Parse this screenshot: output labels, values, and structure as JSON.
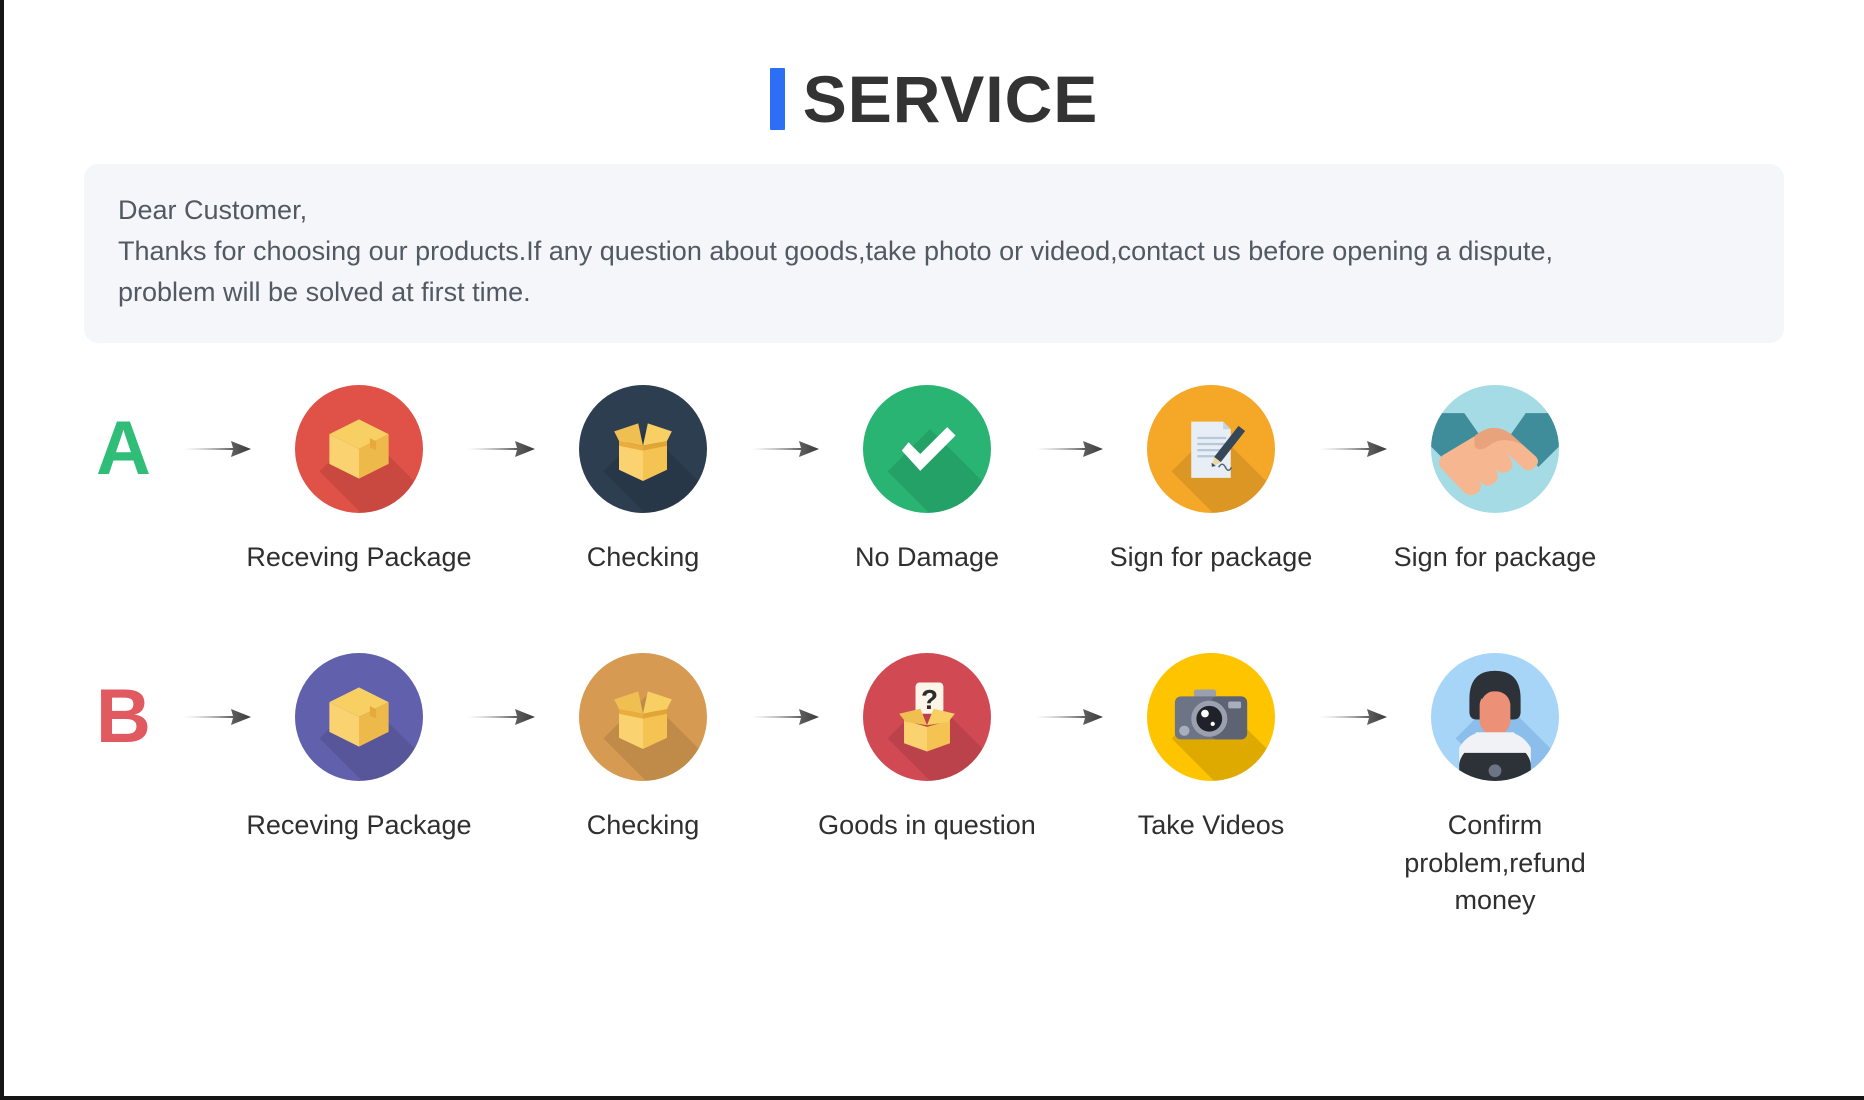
{
  "header": {
    "accent_color": "#2c6ef5",
    "title": "SERVICE"
  },
  "notice": {
    "background_color": "#f4f6f9",
    "line1": "Dear Customer,",
    "line2": "Thanks for choosing our products.If any question about goods,take photo or videod,contact us before opening a dispute,",
    "line3": "problem will be solved at first time."
  },
  "flows": [
    {
      "letter": "A",
      "letter_color": "#2fbd77",
      "steps": [
        {
          "label": "Receving Package",
          "icon": "closed-package-icon",
          "circle_color": "#e05147"
        },
        {
          "label": "Checking",
          "icon": "open-box-icon",
          "circle_color": "#2d3e50"
        },
        {
          "label": "No Damage",
          "icon": "checkmark-icon",
          "circle_color": "#29b473"
        },
        {
          "label": "Sign for package",
          "icon": "document-pen-icon",
          "circle_color": "#f5a828"
        },
        {
          "label": "Sign for package",
          "icon": "handshake-icon",
          "circle_color": "#a5dbe4"
        }
      ]
    },
    {
      "letter": "B",
      "letter_color": "#e05a60",
      "steps": [
        {
          "label": "Receving Package",
          "icon": "closed-package-icon",
          "circle_color": "#6160ad"
        },
        {
          "label": "Checking",
          "icon": "open-box-icon",
          "circle_color": "#d69a52"
        },
        {
          "label": "Goods in question",
          "icon": "question-box-icon",
          "circle_color": "#d14a53"
        },
        {
          "label": "Take Videos",
          "icon": "camera-icon",
          "circle_color": "#ffc400"
        },
        {
          "label": "Confirm problem,refund money",
          "icon": "support-agent-icon",
          "circle_color": "#a7d5f7"
        }
      ]
    }
  ],
  "arrow": {
    "name": "right-arrow-icon",
    "color": "#4a4a4a"
  }
}
